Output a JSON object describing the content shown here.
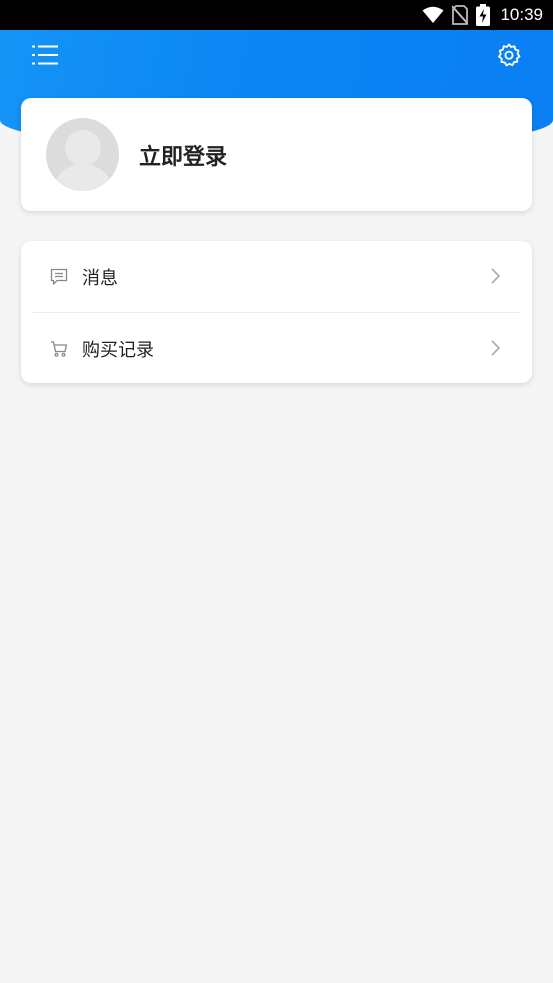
{
  "status_bar": {
    "time": "10:39",
    "icons": [
      "wifi-icon",
      "no-sim-icon",
      "battery-charging-icon"
    ]
  },
  "header": {
    "menu_icon": "list-icon",
    "settings_icon": "gear-icon",
    "colors": {
      "gradient_start": "#1593f5",
      "gradient_end": "#0a7ef3"
    }
  },
  "profile": {
    "avatar_icon": "default-avatar-icon",
    "login_label": "立即登录"
  },
  "menu": {
    "items": [
      {
        "icon": "message-icon",
        "label": "消息"
      },
      {
        "icon": "cart-icon",
        "label": "购买记录"
      }
    ]
  }
}
